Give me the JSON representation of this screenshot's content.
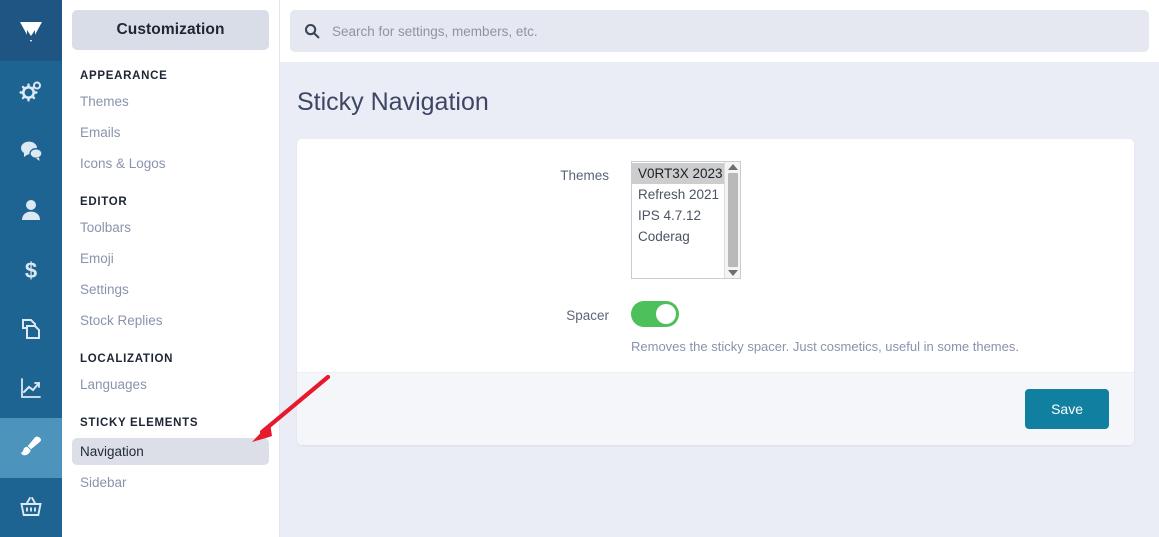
{
  "rail": {
    "logo_icon": "vortex-logo-icon",
    "items": [
      {
        "icon": "gears-icon",
        "name": "system",
        "active": false
      },
      {
        "icon": "chat-bubbles-icon",
        "name": "community",
        "active": false
      },
      {
        "icon": "person-icon",
        "name": "members",
        "active": false
      },
      {
        "icon": "dollar-icon",
        "name": "commerce",
        "active": false
      },
      {
        "icon": "pages-icon",
        "name": "pages",
        "active": false
      },
      {
        "icon": "chart-line-icon",
        "name": "stats",
        "active": false
      },
      {
        "icon": "paintbrush-icon",
        "name": "customization",
        "active": true
      },
      {
        "icon": "basket-icon",
        "name": "store",
        "active": false
      }
    ]
  },
  "sidebar": {
    "title": "Customization",
    "groups": [
      {
        "label": "APPEARANCE",
        "items": [
          {
            "label": "Themes",
            "active": false
          },
          {
            "label": "Emails",
            "active": false
          },
          {
            "label": "Icons & Logos",
            "active": false
          }
        ]
      },
      {
        "label": "EDITOR",
        "items": [
          {
            "label": "Toolbars",
            "active": false
          },
          {
            "label": "Emoji",
            "active": false
          },
          {
            "label": "Settings",
            "active": false
          },
          {
            "label": "Stock Replies",
            "active": false
          }
        ]
      },
      {
        "label": "LOCALIZATION",
        "items": [
          {
            "label": "Languages",
            "active": false
          }
        ]
      },
      {
        "label": "STICKY ELEMENTS",
        "items": [
          {
            "label": "Navigation",
            "active": true
          },
          {
            "label": "Sidebar",
            "active": false
          }
        ]
      }
    ]
  },
  "search": {
    "icon": "search-icon",
    "placeholder": "Search for settings, members, etc.",
    "value": ""
  },
  "page": {
    "title": "Sticky Navigation"
  },
  "form": {
    "themes": {
      "label": "Themes",
      "options": [
        {
          "label": "V0RT3X 2023",
          "selected": true
        },
        {
          "label": "Refresh 2021",
          "selected": false
        },
        {
          "label": "IPS 4.7.12",
          "selected": false
        },
        {
          "label": "Coderag",
          "selected": false
        }
      ]
    },
    "spacer": {
      "label": "Spacer",
      "enabled": true,
      "hint": "Removes the sticky spacer. Just cosmetics, useful in some themes."
    },
    "save_label": "Save"
  },
  "annotation": {
    "arrow_icon": "red-arrow-icon",
    "color": "#e8192c"
  },
  "colors": {
    "rail": "#1d6493",
    "rail_active": "#4d94bd",
    "logo_bg": "#1f5582",
    "page_bg": "#eaedf6",
    "save_button": "#1180a0",
    "toggle_on": "#4cc05a",
    "accent_text": "#8a93ad"
  }
}
